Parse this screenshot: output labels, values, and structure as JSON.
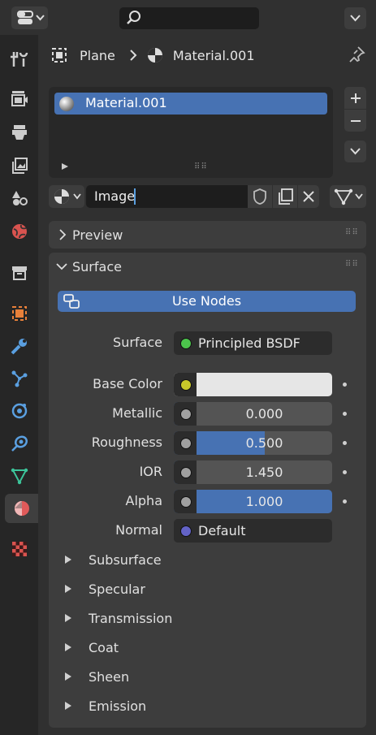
{
  "header": {
    "search_placeholder": ""
  },
  "sidebar": {
    "tabs": [
      {
        "name": "tool",
        "icon": "tool-icon",
        "active": false
      },
      {
        "name": "render",
        "icon": "render-icon",
        "active": false
      },
      {
        "name": "output",
        "icon": "output-icon",
        "active": false
      },
      {
        "name": "view-layer",
        "icon": "view-layer-icon",
        "active": false
      },
      {
        "name": "scene",
        "icon": "scene-icon",
        "active": false
      },
      {
        "name": "world",
        "icon": "world-icon",
        "active": false
      },
      {
        "name": "collection",
        "icon": "collection-icon",
        "active": false
      },
      {
        "name": "object",
        "icon": "object-icon",
        "active": false
      },
      {
        "name": "modifiers",
        "icon": "wrench-icon",
        "active": false
      },
      {
        "name": "particles",
        "icon": "particles-icon",
        "active": false
      },
      {
        "name": "physics",
        "icon": "physics-icon",
        "active": false
      },
      {
        "name": "constraints",
        "icon": "constraints-icon",
        "active": false
      },
      {
        "name": "data",
        "icon": "mesh-data-icon",
        "active": false
      },
      {
        "name": "material",
        "icon": "material-icon",
        "active": true
      },
      {
        "name": "texture",
        "icon": "texture-icon",
        "active": false
      }
    ]
  },
  "breadcrumb": {
    "object": "Plane",
    "material": "Material.001"
  },
  "material_slots": {
    "items": [
      "Material.001"
    ]
  },
  "datablock": {
    "name": "Image"
  },
  "panels": {
    "preview": "Preview",
    "surface": "Surface"
  },
  "surface": {
    "use_nodes_label": "Use Nodes",
    "surface_label": "Surface",
    "surface_value": "Principled BSDF",
    "surface_socket_color": "#4cc44c",
    "properties": [
      {
        "label": "Base Color",
        "type": "color",
        "value": "",
        "socket_color": "#c8c82a",
        "swatch": "#e6e6e6"
      },
      {
        "label": "Metallic",
        "type": "float",
        "value": "0.000",
        "fraction": 0.0,
        "socket_color": "#a0a0a0"
      },
      {
        "label": "Roughness",
        "type": "float",
        "value": "0.500",
        "fraction": 0.5,
        "socket_color": "#a0a0a0"
      },
      {
        "label": "IOR",
        "type": "float",
        "value": "1.450",
        "fraction": 0.0,
        "socket_color": "#a0a0a0"
      },
      {
        "label": "Alpha",
        "type": "float",
        "value": "1.000",
        "fraction": 1.0,
        "socket_color": "#a0a0a0"
      },
      {
        "label": "Normal",
        "type": "link",
        "value": "Default",
        "socket_color": "#6363c7"
      }
    ],
    "subpanels": [
      "Subsurface",
      "Specular",
      "Transmission",
      "Coat",
      "Sheen",
      "Emission"
    ]
  },
  "colors": {
    "accent": "#4772b3",
    "background": "#303030",
    "panel": "#3d3d3d"
  }
}
